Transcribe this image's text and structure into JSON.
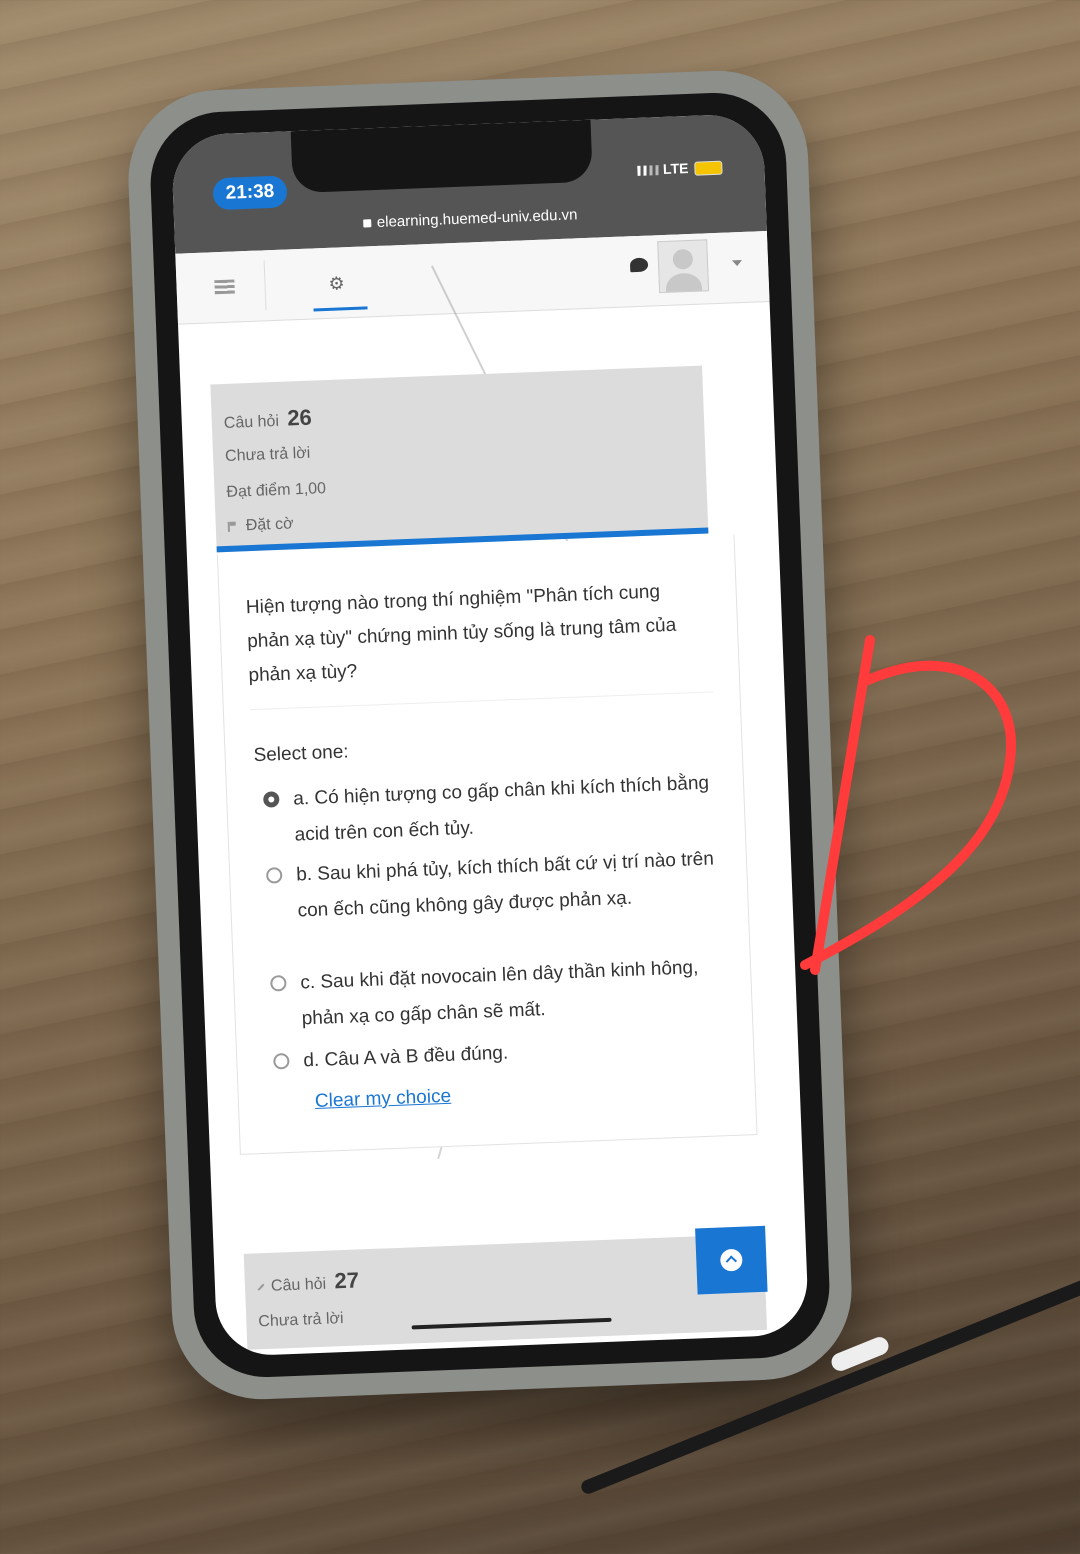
{
  "status_bar": {
    "time": "21:38",
    "network": "LTE"
  },
  "browser": {
    "url": "elearning.huemed-univ.edu.vn"
  },
  "question_info": {
    "label": "Câu hỏi",
    "number": "26",
    "status": "Chưa trả lời",
    "marks": "Đạt điểm 1,00",
    "flag_label": "Đặt cờ"
  },
  "question": {
    "text": "Hiện tượng nào trong thí nghiệm \"Phân tích cung phản xạ tùy\" chứng minh tủy sống là trung tâm của phản xạ tùy?",
    "prompt": "Select one:",
    "answers": [
      {
        "label": "a. Có hiện tượng co gấp chân khi kích thích bằng acid trên con ếch tủy.",
        "selected": true
      },
      {
        "label": "b. Sau khi phá tủy, kích thích bất cứ vị trí nào trên con ếch cũng không gây được phản xạ.",
        "selected": false
      },
      {
        "label": "c. Sau khi đặt novocain lên dây thần kinh hông, phản xạ co gấp chân sẽ mất.",
        "selected": false
      },
      {
        "label": "d. Câu A và B đều đúng.",
        "selected": false
      }
    ],
    "clear_label": "Clear my choice"
  },
  "next_question": {
    "label": "Câu hỏi",
    "number": "27",
    "status": "Chưa trả lời"
  },
  "colors": {
    "accent": "#1976d2",
    "annotation": "#ff3b3b"
  },
  "icons": [
    "hamburger-icon",
    "gears-icon",
    "chat-icon",
    "avatar",
    "caret-icon",
    "flag-icon",
    "pencil-icon",
    "chevron-up-icon"
  ]
}
